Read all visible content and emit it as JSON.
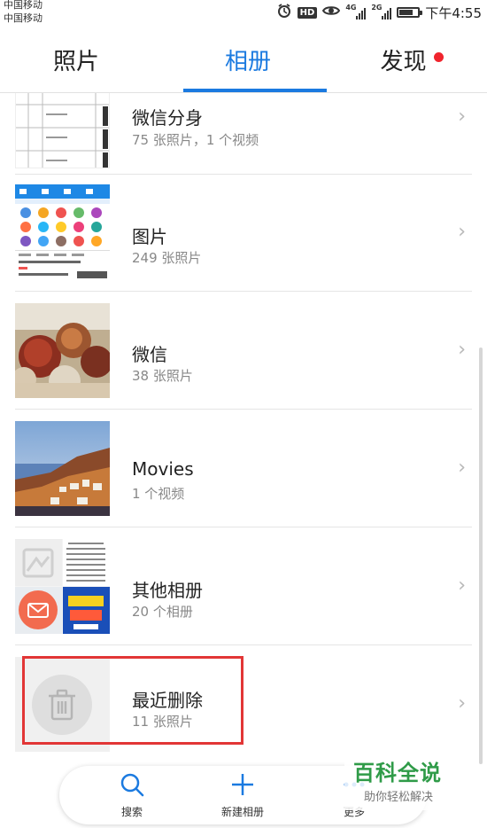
{
  "status_bar": {
    "carrier_1": "中国移动",
    "carrier_2": "中国移动",
    "net_1": "4G",
    "net_2": "2G",
    "battery_level": 0.85,
    "time": "下午4:55",
    "hd_badge": "HD"
  },
  "tabs": [
    {
      "label": "照片",
      "active": false
    },
    {
      "label": "相册",
      "active": true
    },
    {
      "label": "发现",
      "active": false,
      "badge_dot": true
    }
  ],
  "albums": [
    {
      "title": "微信分身",
      "subtitle": "75 张照片，1 个视频",
      "thumb": "screenshot-list-thumbnail"
    },
    {
      "title": "图片",
      "subtitle": "249 张照片",
      "thumb": "app-screenshot-thumbnail"
    },
    {
      "title": "微信",
      "subtitle": "38 张照片",
      "thumb": "apples-photo-thumbnail"
    },
    {
      "title": "Movies",
      "subtitle": "1 个视频",
      "thumb": "santorini-sunset-thumbnail"
    },
    {
      "title": "其他相册",
      "subtitle": "20 个相册",
      "thumb": "collage-thumbnail"
    },
    {
      "title": "最近删除",
      "subtitle": "11 张照片",
      "thumb": "trash-icon-thumbnail"
    }
  ],
  "bottom_bar": {
    "search_label": "搜索",
    "new_album_label": "新建相册",
    "more_label": "更多"
  },
  "watermark": {
    "title": "百科全说",
    "subtitle": "助你轻松解决"
  },
  "colors": {
    "accent": "#1b7ae0",
    "badge_dot": "#f0242d",
    "highlight_box": "#e23636",
    "watermark_green": "#2f9b48"
  }
}
